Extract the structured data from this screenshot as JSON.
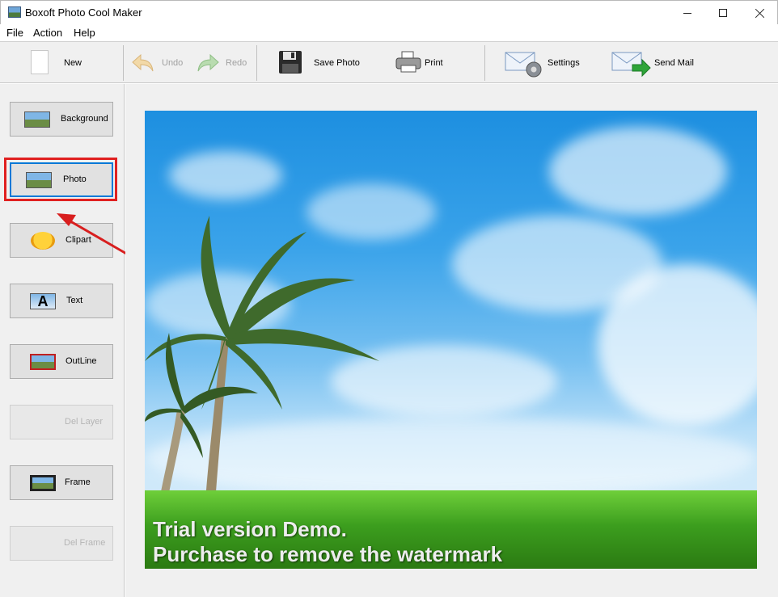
{
  "window": {
    "title": "Boxoft Photo Cool Maker"
  },
  "menu": {
    "items": [
      "File",
      "Action",
      "Help"
    ]
  },
  "toolbar": {
    "new_label": "New",
    "undo_label": "Undo",
    "redo_label": "Redo",
    "save_photo_label": "Save Photo",
    "print_label": "Print",
    "settings_label": "Settings",
    "send_mail_label": "Send Mail"
  },
  "sidebar": {
    "items": [
      {
        "label": "Background",
        "enabled": true
      },
      {
        "label": "Photo",
        "enabled": true,
        "selected": true
      },
      {
        "label": "Clipart",
        "enabled": true
      },
      {
        "label": "Text",
        "enabled": true
      },
      {
        "label": "OutLine",
        "enabled": true
      },
      {
        "label": "Del Layer",
        "enabled": false
      },
      {
        "label": "Frame",
        "enabled": true
      },
      {
        "label": "Del Frame",
        "enabled": false
      }
    ]
  },
  "canvas": {
    "watermark_line1": "Trial version Demo.",
    "watermark_line2": "Purchase to remove the watermark"
  },
  "colors": {
    "highlight": "#e02020",
    "selected_border": "#0078d7",
    "panel_bg": "#f0f0f0"
  }
}
